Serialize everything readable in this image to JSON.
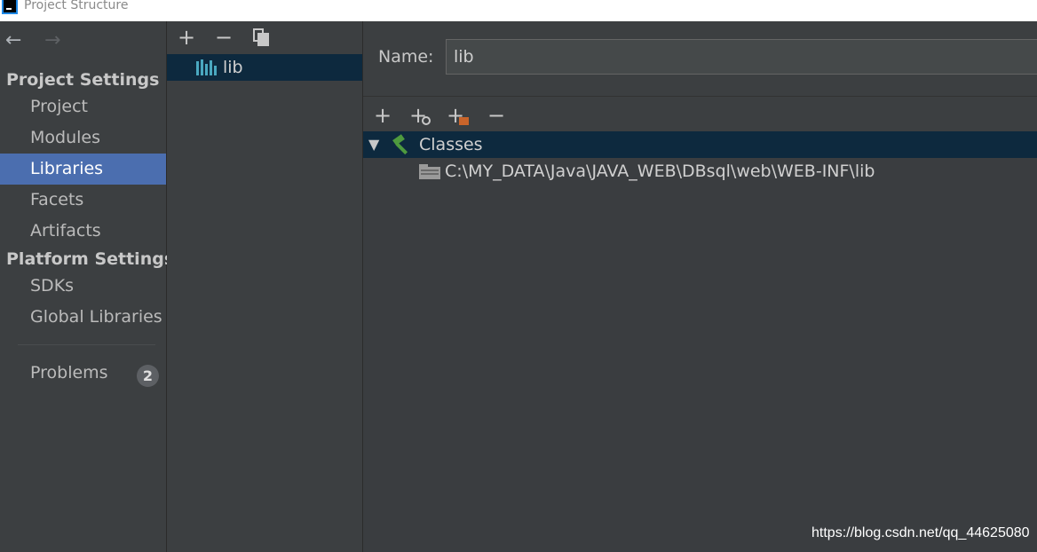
{
  "window": {
    "title": "Project Structure",
    "app_icon": "intellij-icon"
  },
  "nav": {
    "back_icon": "arrow-left-icon",
    "forward_icon": "arrow-right-icon",
    "project_settings_header": "Project Settings",
    "project_settings": [
      {
        "label": "Project",
        "selected": false
      },
      {
        "label": "Modules",
        "selected": false
      },
      {
        "label": "Libraries",
        "selected": true
      },
      {
        "label": "Facets",
        "selected": false
      },
      {
        "label": "Artifacts",
        "selected": false
      }
    ],
    "platform_settings_header": "Platform Settings",
    "platform_settings": [
      {
        "label": "SDKs"
      },
      {
        "label": "Global Libraries"
      }
    ],
    "problems": {
      "label": "Problems",
      "count": "2"
    }
  },
  "libraries_list": {
    "toolbar": [
      "add-icon",
      "remove-icon",
      "copy-icon"
    ],
    "items": [
      {
        "label": "lib",
        "icon": "library-icon",
        "selected": true
      }
    ]
  },
  "detail": {
    "name_label": "Name:",
    "name_value": "lib",
    "toolbar": [
      "add-icon",
      "add-url-icon",
      "add-folder-icon",
      "remove-icon"
    ],
    "tree": {
      "root_label": "Classes",
      "root_icon": "hammer-icon",
      "children": [
        {
          "label": "C:\\MY_DATA\\Java\\JAVA_WEB\\DBsql\\web\\WEB-INF\\lib",
          "icon": "jar-directory-icon"
        }
      ]
    }
  },
  "watermark": "https://blog.csdn.net/qq_44625080",
  "colors": {
    "background": "#3c3f41",
    "selection": "#4b6eaf",
    "tree_selection": "#0d293e",
    "hammer": "#4e9a3e",
    "library_bars": "#4aa8c0"
  }
}
